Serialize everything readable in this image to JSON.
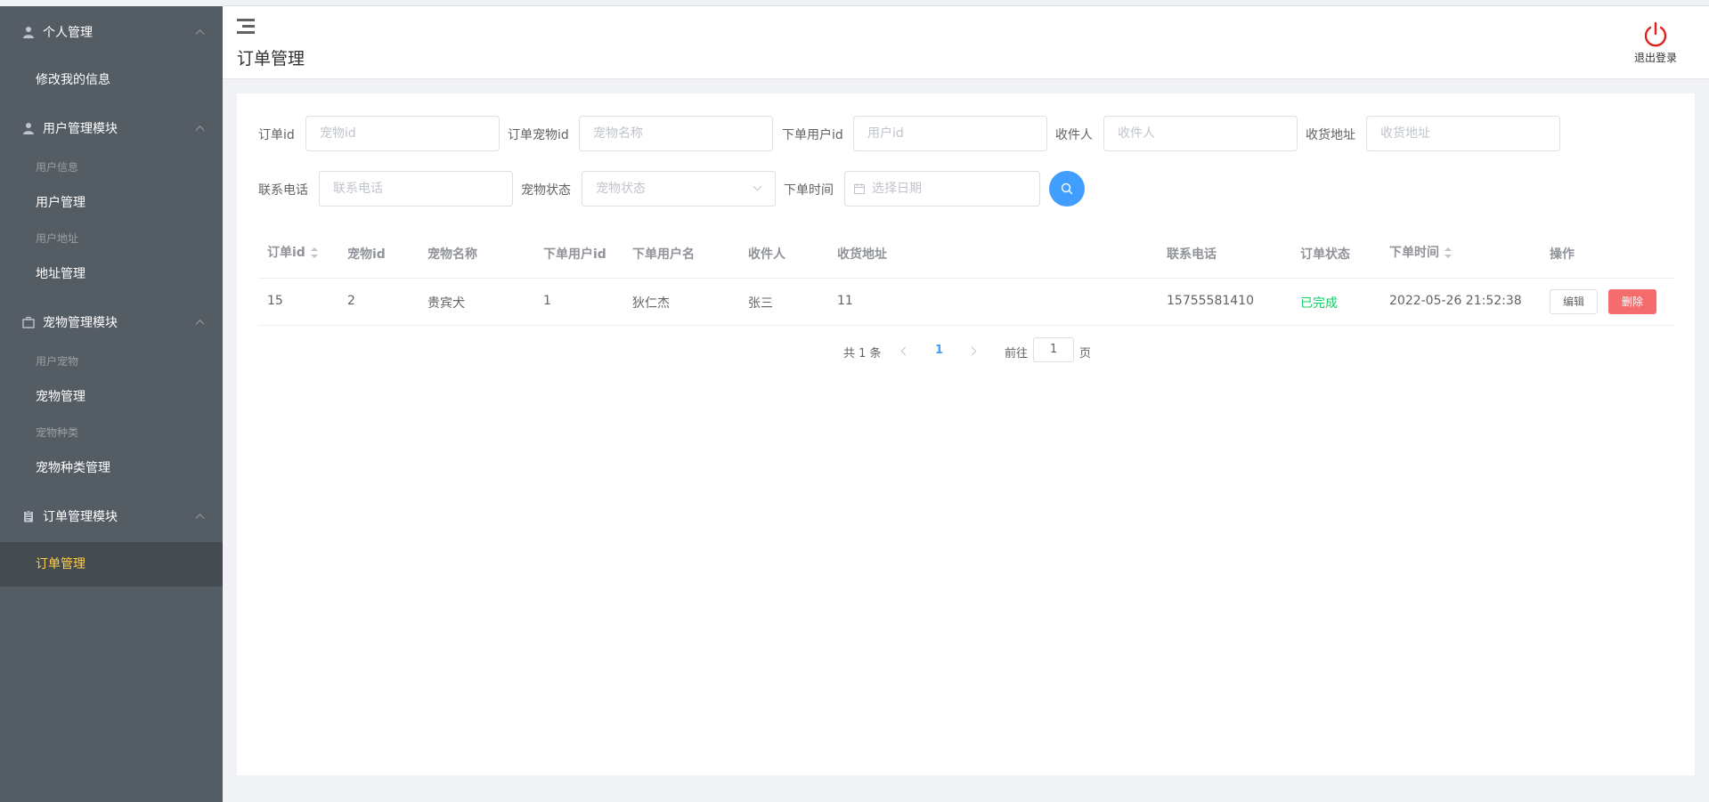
{
  "sidebar": {
    "groups": [
      {
        "title": "个人管理",
        "icon": "user-icon",
        "items": [
          {
            "label": "修改我的信息",
            "style": "bold"
          }
        ]
      },
      {
        "title": "用户管理模块",
        "icon": "user-icon",
        "items": [
          {
            "label": "用户信息",
            "style": "muted"
          },
          {
            "label": "用户管理",
            "style": "bold"
          },
          {
            "label": "用户地址",
            "style": "muted"
          },
          {
            "label": "地址管理",
            "style": "bold"
          }
        ]
      },
      {
        "title": "宠物管理模块",
        "icon": "briefcase-icon",
        "items": [
          {
            "label": "用户宠物",
            "style": "muted"
          },
          {
            "label": "宠物管理",
            "style": "bold"
          },
          {
            "label": "宠物种类",
            "style": "muted"
          },
          {
            "label": "宠物种类管理",
            "style": "bold"
          }
        ]
      },
      {
        "title": "订单管理模块",
        "icon": "clipboard-icon",
        "items": [
          {
            "label": "订单管理",
            "style": "active"
          }
        ]
      }
    ]
  },
  "header": {
    "title": "订单管理",
    "logout_label": "退出登录"
  },
  "filters": {
    "order_id": {
      "label": "订单id",
      "placeholder": "宠物id"
    },
    "pet_id": {
      "label": "订单宠物id",
      "placeholder": "宠物名称"
    },
    "user_id": {
      "label": "下单用户id",
      "placeholder": "用户id"
    },
    "receiver": {
      "label": "收件人",
      "placeholder": "收件人"
    },
    "address": {
      "label": "收货地址",
      "placeholder": "收货地址"
    },
    "phone": {
      "label": "联系电话",
      "placeholder": "联系电话"
    },
    "pet_status": {
      "label": "宠物状态",
      "placeholder": "宠物状态"
    },
    "order_time": {
      "label": "下单时间",
      "placeholder": "选择日期"
    }
  },
  "table": {
    "columns": [
      "订单id",
      "宠物id",
      "宠物名称",
      "下单用户id",
      "下单用户名",
      "收件人",
      "收货地址",
      "联系电话",
      "订单状态",
      "下单时间",
      "操作"
    ],
    "rows": [
      {
        "order_id": "15",
        "pet_id": "2",
        "pet_name": "贵宾犬",
        "user_id": "1",
        "user_name": "狄仁杰",
        "receiver": "张三",
        "address": "11",
        "phone": "15755581410",
        "status": "已完成",
        "time": "2022-05-26 21:52:38",
        "edit_label": "编辑",
        "delete_label": "删除"
      }
    ]
  },
  "pagination": {
    "total_text": "共 1 条",
    "current_page": "1",
    "goto_prefix": "前往",
    "goto_value": "1",
    "goto_suffix": "页"
  },
  "colors": {
    "sidebar_bg": "#545c64",
    "active_text": "#ffd04b",
    "primary": "#409eff",
    "danger": "#f56c6c",
    "success": "#13ce66",
    "logout_icon": "#e02020"
  }
}
